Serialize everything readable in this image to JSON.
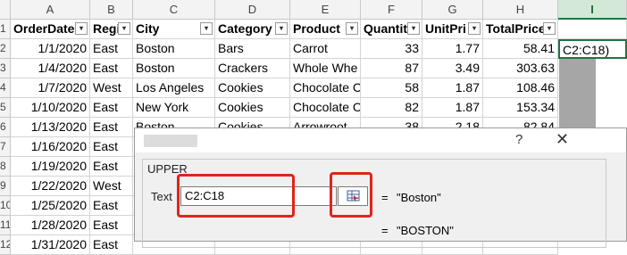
{
  "columns": {
    "row_num": "",
    "a": "A",
    "b": "B",
    "c": "C",
    "d": "D",
    "e": "E",
    "f": "F",
    "g": "G",
    "h": "H",
    "i": "I"
  },
  "headers": [
    "OrderDate",
    "Regi",
    "City",
    "Category",
    "Product",
    "Quantit",
    "UnitPri",
    "TotalPrice"
  ],
  "rows": [
    {
      "n": "2",
      "date": "1/1/2020",
      "region": "East",
      "city": "Boston",
      "category": "Bars",
      "product": "Carrot",
      "qty": "33",
      "unit": "1.77",
      "total": "58.41"
    },
    {
      "n": "3",
      "date": "1/4/2020",
      "region": "East",
      "city": "Boston",
      "category": "Crackers",
      "product": "Whole Whe",
      "qty": "87",
      "unit": "3.49",
      "total": "303.63"
    },
    {
      "n": "4",
      "date": "1/7/2020",
      "region": "West",
      "city": "Los Angeles",
      "category": "Cookies",
      "product": "Chocolate C",
      "qty": "58",
      "unit": "1.87",
      "total": "108.46"
    },
    {
      "n": "5",
      "date": "1/10/2020",
      "region": "East",
      "city": "New York",
      "category": "Cookies",
      "product": "Chocolate C",
      "qty": "82",
      "unit": "1.87",
      "total": "153.34"
    },
    {
      "n": "6",
      "date": "1/13/2020",
      "region": "East",
      "city": "Boston",
      "category": "Cookies",
      "product": "Arrowroot",
      "qty": "38",
      "unit": "2.18",
      "total": "82.84"
    },
    {
      "n": "7",
      "date": "1/16/2020",
      "region": "East"
    },
    {
      "n": "8",
      "date": "1/19/2020",
      "region": "East"
    },
    {
      "n": "9",
      "date": "1/22/2020",
      "region": "West"
    },
    {
      "n": "10",
      "date": "1/25/2020",
      "region": "East"
    },
    {
      "n": "11",
      "date": "1/28/2020",
      "region": "East"
    },
    {
      "n": "12",
      "date": "1/31/2020",
      "region": "East"
    }
  ],
  "formula_cell": "C2:C18)",
  "dialog": {
    "function_name": "UPPER",
    "arg_label": "Text",
    "arg_value": "C2:C18",
    "eq1": "=",
    "result1": "\"Boston\"",
    "eq2": "=",
    "result2": "\"BOSTON\"",
    "help": "?",
    "close": "✕"
  },
  "colors": {
    "highlight": "#e0241c",
    "selected_col": "#217346",
    "range_fill": "#a6a6a6"
  }
}
